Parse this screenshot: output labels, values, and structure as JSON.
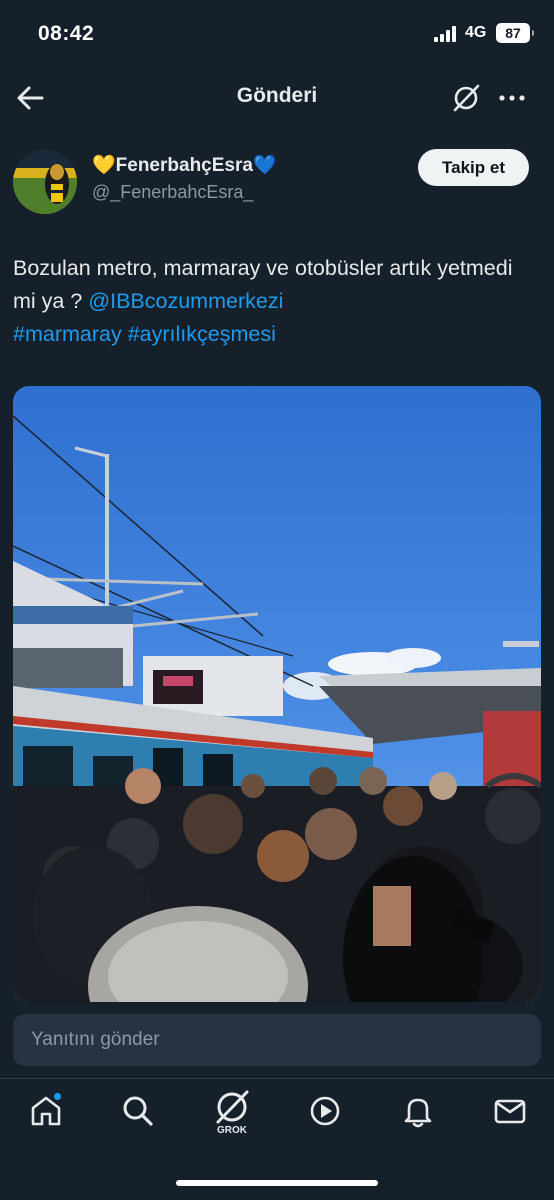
{
  "status_bar": {
    "time": "08:42",
    "network": "4G",
    "battery": "87"
  },
  "header": {
    "title": "Gönderi"
  },
  "author": {
    "display_name": "💛FenerbahçEsra💙",
    "handle": "@_FenerbahcEsra_",
    "follow_label": "Takip et"
  },
  "tweet": {
    "text_plain": "Bozulan metro, marmaray ve otobüsler artık yetmedi mi ya ? ",
    "mention": "@IBBcozummerkezi",
    "hashtag_1": "#marmaray",
    "hashtag_2": "#ayrılıkçeşmesi"
  },
  "reply": {
    "placeholder": "Yanıtını gönder"
  },
  "tab_bar": {
    "items": [
      {
        "icon": "home-icon",
        "has_dot": true
      },
      {
        "icon": "search-icon"
      },
      {
        "icon": "grok-icon",
        "label": "GROK"
      },
      {
        "icon": "video-icon"
      },
      {
        "icon": "notifications-icon"
      },
      {
        "icon": "messages-icon"
      }
    ]
  },
  "colors": {
    "background": "#15202b",
    "accent": "#1d9bf0",
    "text_primary": "#e7e9ea",
    "text_secondary": "#8b98a5"
  }
}
